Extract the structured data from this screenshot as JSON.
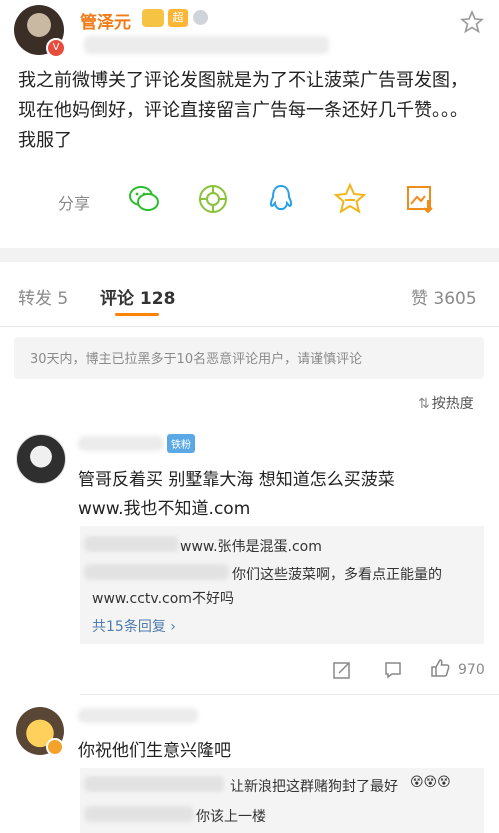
{
  "post": {
    "author": "管泽元",
    "badge_label": "超",
    "text": "我之前微博关了评论发图就是为了不让菠菜广告哥发图，现在他妈倒好，评论直接留言广告每一条还好几千赞。。。我服了"
  },
  "share": {
    "label": "分享"
  },
  "tabs": {
    "repost": "转发 5",
    "comments": "评论 128",
    "likes": "赞 3605"
  },
  "notice": "30天内，博主已拉黑多于10名恶意评论用户，请谨慎评论",
  "sort": {
    "label": "按热度"
  },
  "comments": [
    {
      "badge": "铁粉",
      "text_line1": "管哥反着买 别墅靠大海 想知道怎么买菠菜",
      "text_line2": "www.我也不知道.com",
      "reply1": "www.张伟是混蛋.com",
      "reply2_a": "你们这些菠菜啊，多看点正能量的",
      "reply2_b": "www.cctv.com不好吗",
      "replies_link": "共15条回复 ›",
      "like_count": "970"
    },
    {
      "text": "你祝他们生意兴隆吧",
      "reply1": "让新浪把这群赌狗封了最好",
      "reply2": "你该上一楼"
    }
  ]
}
